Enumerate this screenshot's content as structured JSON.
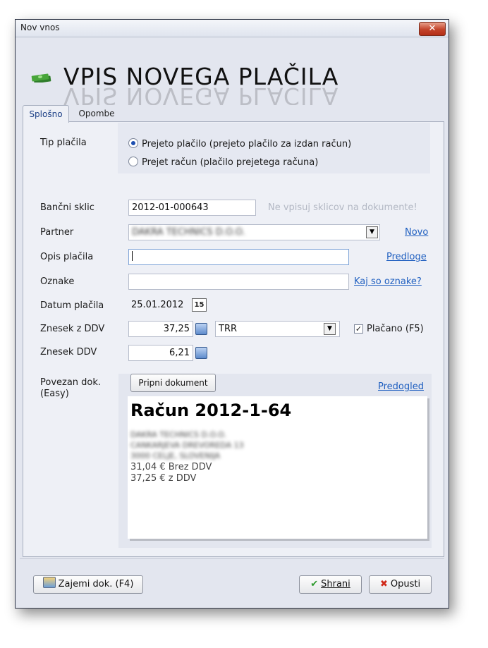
{
  "window": {
    "title": "Nov vnos",
    "close_glyph": "✕"
  },
  "header": {
    "title": "VPIS NOVEGA PLAČILA",
    "icon": "money-icon"
  },
  "tabs": [
    {
      "label": "Splošno",
      "active": true
    },
    {
      "label": "Opombe",
      "active": false
    }
  ],
  "payment_type": {
    "label": "Tip plačila",
    "options": [
      {
        "label": "Prejeto plačilo (prejeto plačilo za izdan račun)",
        "selected": true
      },
      {
        "label": "Prejet račun (plačilo prejetega računa)",
        "selected": false
      }
    ]
  },
  "bank_ref": {
    "label": "Bančni sklic",
    "value": "2012-01-000643",
    "hint": "Ne vpisuj sklicov na dokumente!"
  },
  "partner": {
    "label": "Partner",
    "value": "DAKRA TECHNICS D.O.O.",
    "link": "Novo"
  },
  "description": {
    "label": "Opis plačila",
    "value": "",
    "link": "Predloge"
  },
  "tags": {
    "label": "Oznake",
    "value": "",
    "link": "Kaj so oznake?"
  },
  "date": {
    "label": "Datum plačila",
    "value": "25.01.2012",
    "calendar_glyph": "15"
  },
  "amount_with_vat": {
    "label": "Znesek z DDV",
    "value": "37,25",
    "account": "TRR",
    "paid_label": "Plačano (F5)",
    "paid_checked": true
  },
  "vat_amount": {
    "label": "Znesek DDV",
    "value": "6,21"
  },
  "linked_doc": {
    "label": "Povezan dok.",
    "label2": "(Easy)",
    "attach_button": "Pripni dokument",
    "preview_link": "Predogled",
    "preview": {
      "title": "Račun 2012-1-64",
      "company": "DAKRA TECHNICS D.O.O.",
      "street": "CANKARJEVA DREVOREDA 13",
      "city": "3000 CELJE, SLOVENIJA",
      "net": "31,04 € Brez DDV",
      "gross": "37,25 € z DDV"
    }
  },
  "footer": {
    "capture_button": "Zajemi dok. (F4)",
    "save_button": "Shrani",
    "cancel_button": "Opusti"
  },
  "colors": {
    "accent": "#1f5fc0",
    "window_bg": "#e3e6ef",
    "panel_bg": "#eef0f6"
  }
}
